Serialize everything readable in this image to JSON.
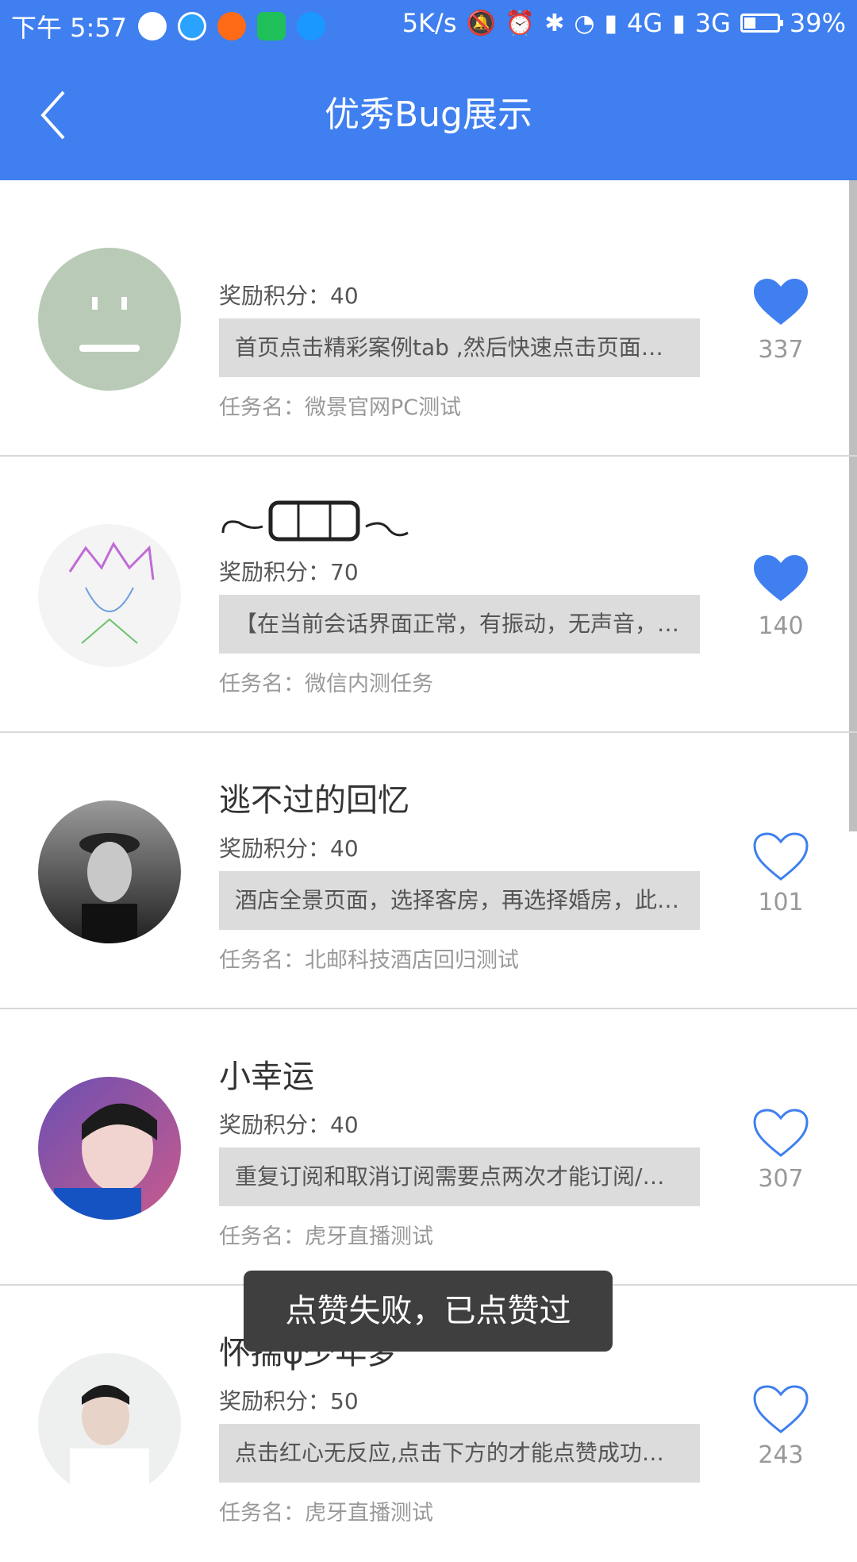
{
  "status_bar": {
    "time": "下午 5:57",
    "speed": "5K/s",
    "net1": "4G",
    "net2": "3G",
    "battery": "39%",
    "battery_level": 0.39,
    "app_icons": [
      "qq-icon",
      "browser-icon",
      "crop-app-icon",
      "wps-icon",
      "upload-app-icon"
    ]
  },
  "header": {
    "title": "优秀Bug展示"
  },
  "items": [
    {
      "name": "",
      "reward": "奖励积分：40",
      "desc": "首页点击精彩案例tab ,然后快速点击页面上…",
      "task": "任务名：微景官网PC测试",
      "likes": "337",
      "liked": true
    },
    {
      "name": "",
      "reward": "奖励积分：70",
      "desc": "【在当前会话界面正常，有振动，无声音，…",
      "task": "任务名：微信内测任务",
      "likes": "140",
      "liked": true
    },
    {
      "name": "逃不过的回忆",
      "reward": "奖励积分：40",
      "desc": "酒店全景页面，选择客房，再选择婚房，此…",
      "task": "任务名：北邮科技酒店回归测试",
      "likes": "101",
      "liked": false
    },
    {
      "name": "小幸运",
      "reward": "奖励积分：40",
      "desc": "重复订阅和取消订阅需要点两次才能订阅/取…",
      "task": "任务名：虎牙直播测试",
      "likes": "307",
      "liked": false
    },
    {
      "name": "怀揣ψ少年梦",
      "reward": "奖励积分：50",
      "desc": "点击红心无反应,点击下方的才能点赞成功…",
      "task": "任务名：虎牙直播测试",
      "likes": "243",
      "liked": false
    }
  ],
  "toast": "点赞失败，已点赞过",
  "colors": {
    "primary": "#3f7ff0",
    "desc_bg": "#dcdcdc",
    "toast_bg": "#3f3f3f"
  }
}
